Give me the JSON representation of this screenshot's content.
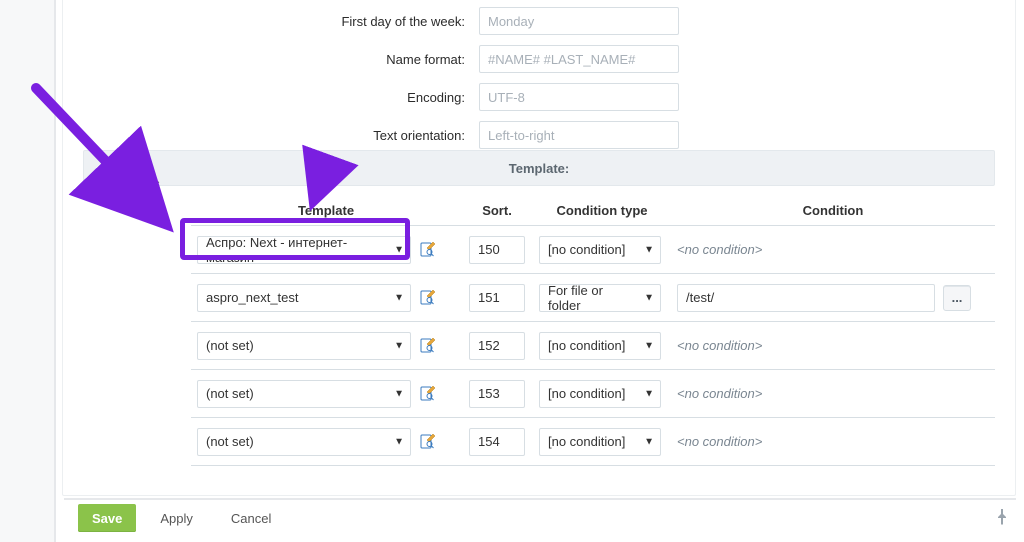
{
  "form": {
    "weekday_label": "First day of the week:",
    "weekday_value": "Monday",
    "nameformat_label": "Name format:",
    "nameformat_value": "#NAME# #LAST_NAME#",
    "encoding_label": "Encoding:",
    "encoding_value": "UTF-8",
    "orientation_label": "Text orientation:",
    "orientation_value": "Left-to-right"
  },
  "section_title": "Template:",
  "columns": {
    "template": "Template",
    "sort": "Sort.",
    "condition_type": "Condition type",
    "condition": "Condition"
  },
  "rows": [
    {
      "template": "Аспро: Next - интернет-магазин",
      "sort": "150",
      "ctype": "[no condition]",
      "condition": "<no condition>",
      "cond_input": "",
      "has_input": false
    },
    {
      "template": "aspro_next_test",
      "sort": "151",
      "ctype": "For file or folder",
      "condition": "",
      "cond_input": "/test/",
      "has_input": true
    },
    {
      "template": "(not set)",
      "sort": "152",
      "ctype": "[no condition]",
      "condition": "<no condition>",
      "cond_input": "",
      "has_input": false
    },
    {
      "template": "(not set)",
      "sort": "153",
      "ctype": "[no condition]",
      "condition": "<no condition>",
      "cond_input": "",
      "has_input": false
    },
    {
      "template": "(not set)",
      "sort": "154",
      "ctype": "[no condition]",
      "condition": "<no condition>",
      "cond_input": "",
      "has_input": false
    }
  ],
  "buttons": {
    "save": "Save",
    "apply": "Apply",
    "cancel": "Cancel"
  },
  "colors": {
    "highlight": "#7a1fe0",
    "save": "#8bc34a"
  },
  "dots_label": "..."
}
